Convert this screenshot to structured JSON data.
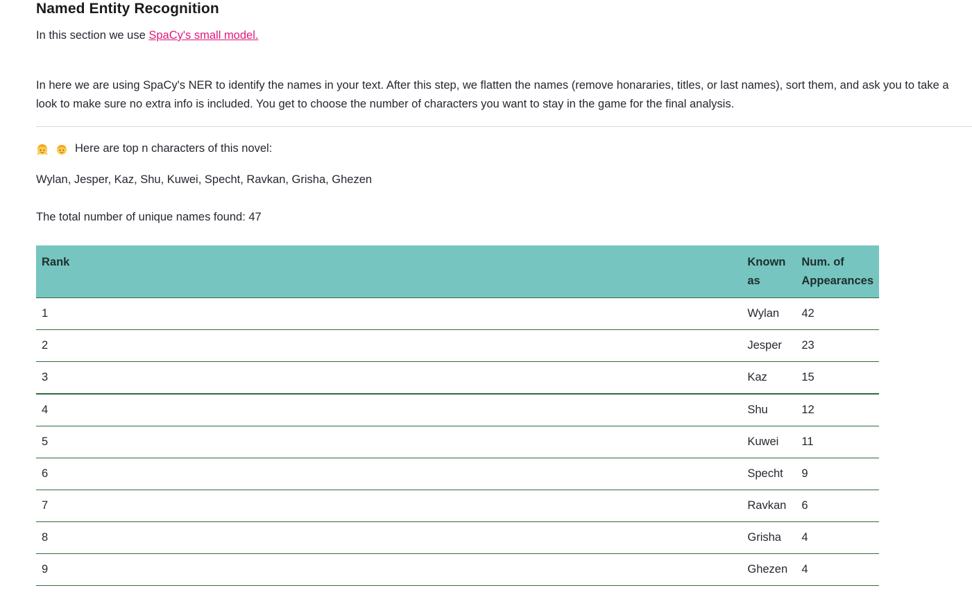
{
  "section": {
    "title": "Named Entity Recognition",
    "intro_prefix": "In this section we use ",
    "intro_link": "SpaCy's small model.",
    "description": "In here we are using SpaCy's NER to identify the names in your text. After this step, we flatten the names (remove honararies, titles, or last names), sort them, and ask you to take a look to make sure no extra info is included. You get to choose the number of characters you want to stay in the game for the final analysis."
  },
  "characters": {
    "heading": "Here are top n characters of this novel:",
    "emoji_icons": [
      "girl-emoji-icon",
      "boy-emoji-icon"
    ],
    "list": "Wylan, Jesper, Kaz, Shu, Kuwei, Specht, Ravkan, Grisha, Ghezen",
    "total": "The total number of unique names found: 47"
  },
  "table": {
    "headers": {
      "rank": "Rank",
      "known_as": "Known as",
      "appearances": "Num. of Appearances"
    },
    "rows": [
      {
        "rank": "1",
        "name": "Wylan",
        "count": "42"
      },
      {
        "rank": "2",
        "name": "Jesper",
        "count": "23"
      },
      {
        "rank": "3",
        "name": "Kaz",
        "count": "15"
      },
      {
        "rank": "4",
        "name": "Shu",
        "count": "12"
      },
      {
        "rank": "5",
        "name": "Kuwei",
        "count": "11"
      },
      {
        "rank": "6",
        "name": "Specht",
        "count": "9"
      },
      {
        "rank": "7",
        "name": "Ravkan",
        "count": "6"
      },
      {
        "rank": "8",
        "name": "Grisha",
        "count": "4"
      },
      {
        "rank": "9",
        "name": "Ghezen",
        "count": "4"
      }
    ]
  },
  "colors": {
    "header_bg": "#76c5c1",
    "link": "#e0177a",
    "row_border": "#2f6b3a"
  }
}
